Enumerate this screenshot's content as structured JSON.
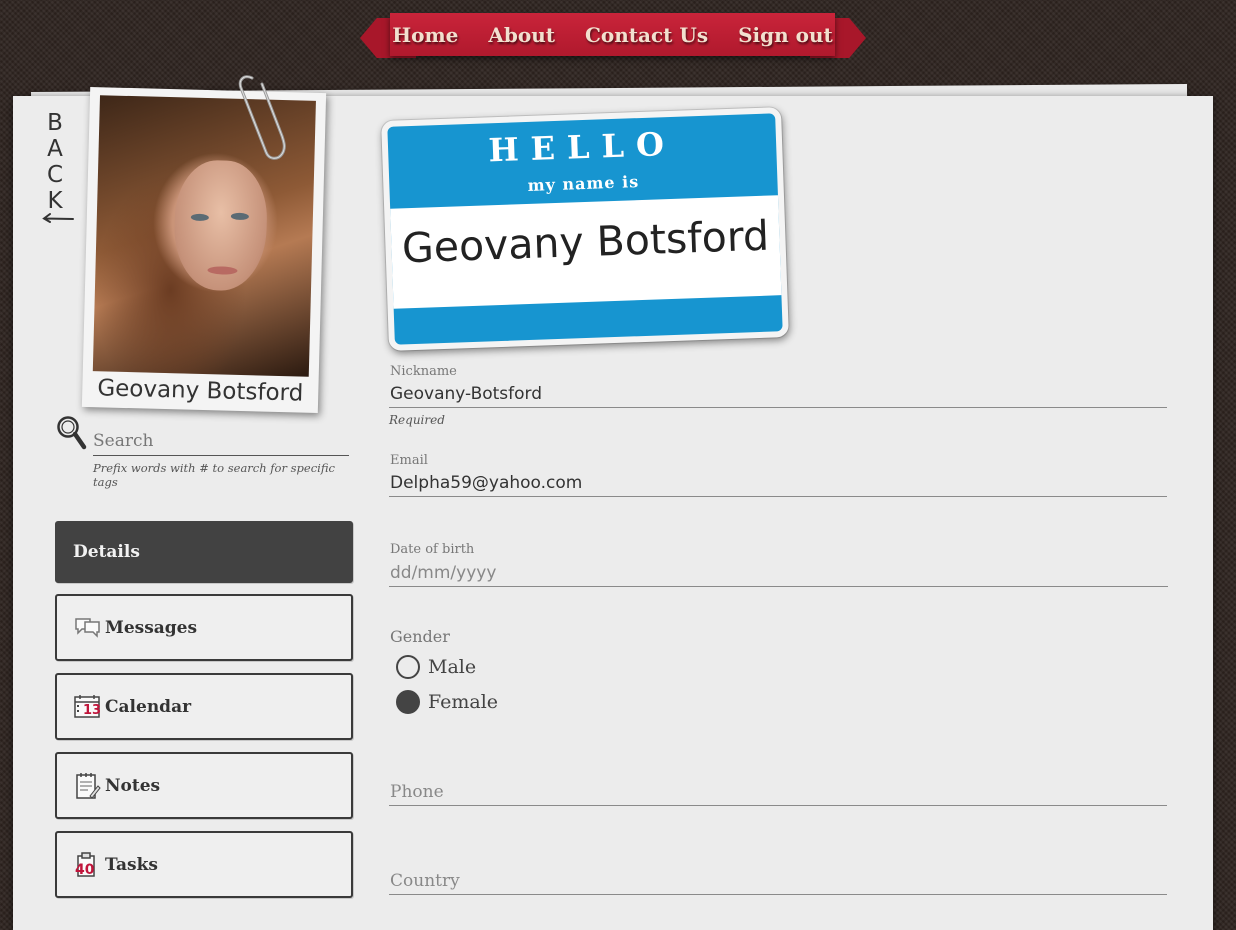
{
  "nav": {
    "items": [
      "Home",
      "About",
      "Contact Us",
      "Sign out"
    ]
  },
  "back": {
    "label": "BACK"
  },
  "profile": {
    "name": "Geovany Botsford",
    "caption": "Geovany Botsford"
  },
  "search": {
    "placeholder": "Search",
    "hint": "Prefix words with # to search for specific tags"
  },
  "menu": {
    "details": "Details",
    "messages": "Messages",
    "calendar": "Calendar",
    "calendar_day": "13",
    "notes": "Notes",
    "tasks": "Tasks",
    "tasks_count": "40"
  },
  "nametag": {
    "hello": "HELLO",
    "subtitle": "my name is",
    "name": "Geovany Botsford"
  },
  "form": {
    "nickname_label": "Nickname",
    "nickname_value": "Geovany-Botsford",
    "nickname_note": "Required",
    "email_label": "Email",
    "email_value": "Delpha59@yahoo.com",
    "dob_label": "Date of birth",
    "dob_placeholder": "dd/mm/yyyy",
    "gender_label": "Gender",
    "gender_options": [
      "Male",
      "Female"
    ],
    "gender_selected": "Female",
    "phone_placeholder": "Phone",
    "country_placeholder": "Country"
  },
  "colors": {
    "ribbon": "#c9243a",
    "tag_blue": "#1795d0",
    "active_menu": "#424242",
    "accent_number": "#c0153b"
  }
}
